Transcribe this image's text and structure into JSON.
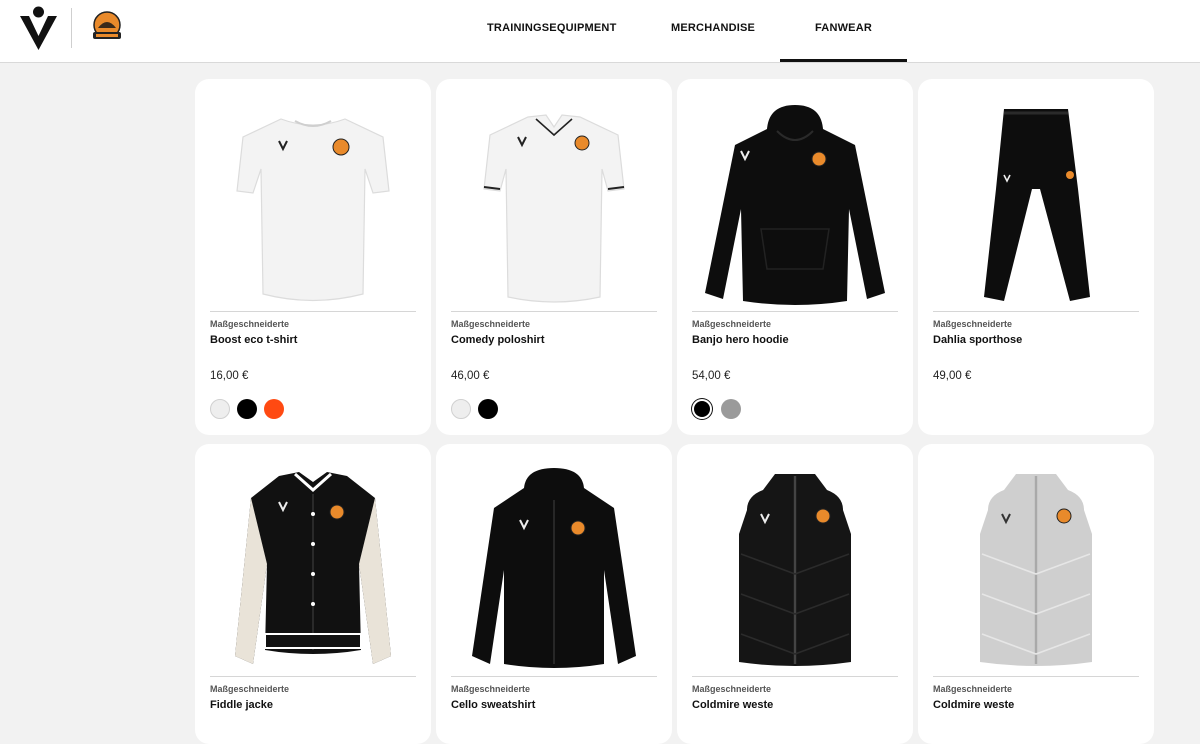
{
  "nav": {
    "items": [
      {
        "label": "TRAININGSEQUIPMENT"
      },
      {
        "label": "MERCHANDISE"
      },
      {
        "label": "FANWEAR"
      }
    ]
  },
  "products": [
    {
      "brand": "Maßgeschneiderte",
      "name": "Boost eco t-shirt",
      "price": "16,00 €",
      "swatches": [
        "#eeeeee",
        "#000000",
        "#ff4a12"
      ]
    },
    {
      "brand": "Maßgeschneiderte",
      "name": "Comedy poloshirt",
      "price": "46,00 €",
      "swatches": [
        "#eeeeee",
        "#000000"
      ]
    },
    {
      "brand": "Maßgeschneiderte",
      "name": "Banjo hero hoodie",
      "price": "54,00 €",
      "swatches": [
        "#000000",
        "#9a9a9a"
      ]
    },
    {
      "brand": "Maßgeschneiderte",
      "name": "Dahlia sporthose",
      "price": "49,00 €",
      "swatches": []
    },
    {
      "brand": "Maßgeschneiderte",
      "name": "Fiddle jacke"
    },
    {
      "brand": "Maßgeschneiderte",
      "name": "Cello sweatshirt"
    },
    {
      "brand": "Maßgeschneiderte",
      "name": "Coldmire weste"
    },
    {
      "brand": "Maßgeschneiderte",
      "name": "Coldmire weste"
    }
  ],
  "colors": {
    "accent": "#111111",
    "background": "#f2f2f2",
    "card": "#ffffff"
  }
}
